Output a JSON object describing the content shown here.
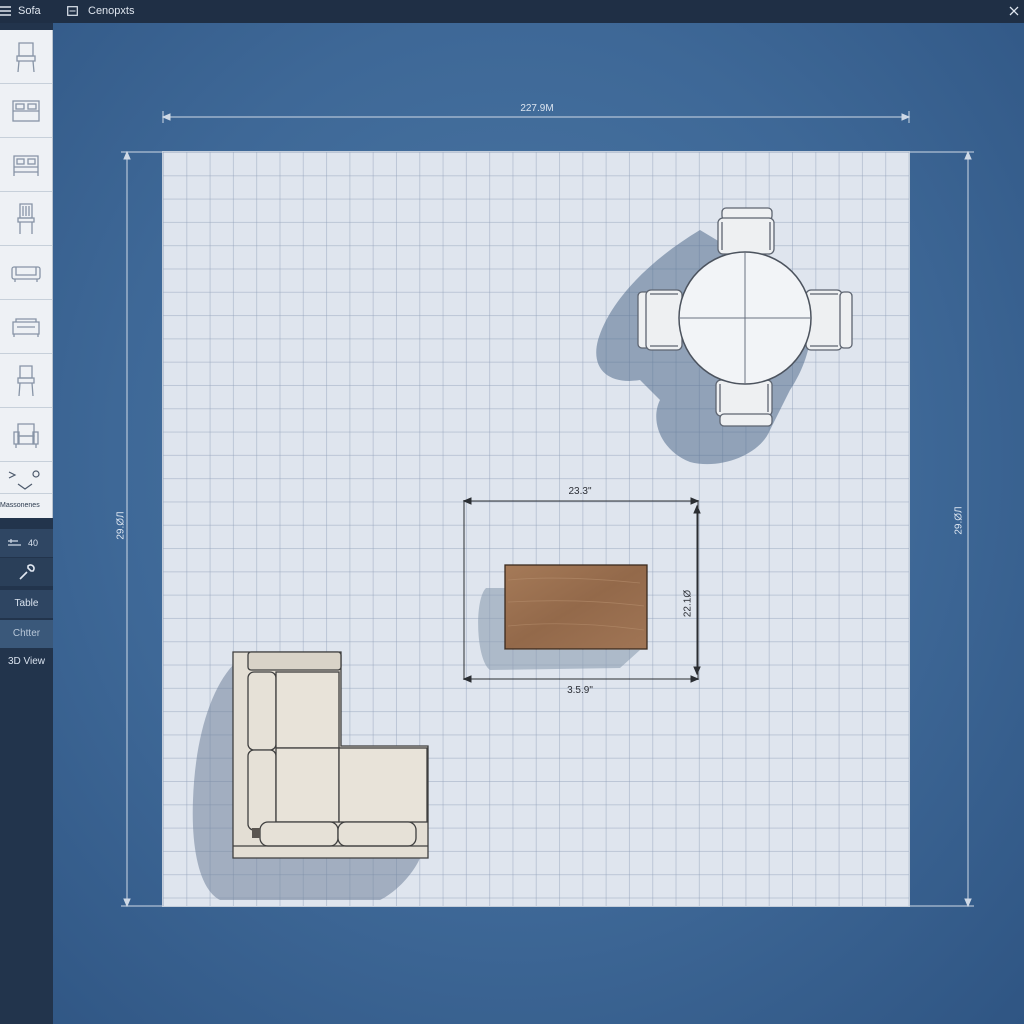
{
  "titlebar": {
    "menu_icon": "menu-icon",
    "sofa_label": "Sofa",
    "doc_icon": "document-icon",
    "concepts_label": "Cenopxts",
    "close_icon": "close-icon"
  },
  "palette": {
    "items": [
      {
        "name": "chair",
        "icon": "chair-icon"
      },
      {
        "name": "bed",
        "icon": "bed-icon"
      },
      {
        "name": "double-bed",
        "icon": "double-bed-icon"
      },
      {
        "name": "side-chair",
        "icon": "side-chair-icon"
      },
      {
        "name": "sofa",
        "icon": "sofa-icon"
      },
      {
        "name": "loveseat",
        "icon": "loveseat-icon"
      },
      {
        "name": "dining-chair",
        "icon": "dining-chair-icon"
      },
      {
        "name": "armchair",
        "icon": "armchair-icon"
      }
    ],
    "label": "Massonenes"
  },
  "sidebar": {
    "tools_value": "40",
    "table_label": "Table",
    "chair_label": "Chtter",
    "view3d_label": "3D View"
  },
  "dimensions": {
    "room_width": "227.9M",
    "room_height_left": "29.ØЛ",
    "room_height_right": "29.ØЛ",
    "table_width": "23.3\"",
    "table_height": "22.1Ø",
    "table_bottom": "3.5.9\""
  },
  "colors": {
    "background": "#3e6897",
    "canvas": "#dfe5ee",
    "sidebar": "#22344c",
    "wood": "#9a6e4e",
    "sofa": "#e3ded4"
  }
}
